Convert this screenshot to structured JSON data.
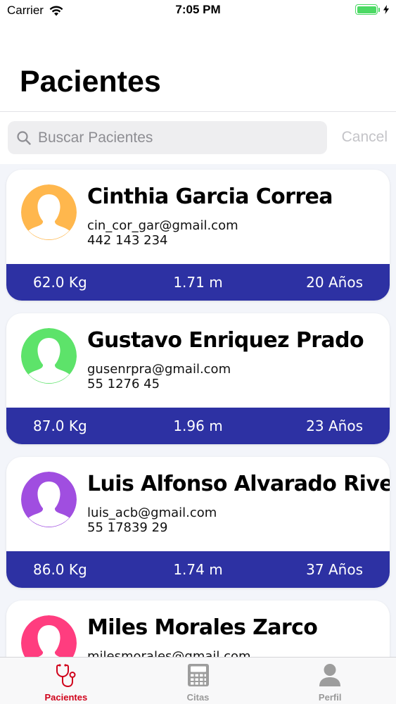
{
  "status_bar": {
    "carrier": "Carrier",
    "time": "7:05 PM"
  },
  "header": {
    "title": "Pacientes"
  },
  "search": {
    "placeholder": "Buscar Pacientes",
    "value": "",
    "cancel_label": "Cancel"
  },
  "patients": [
    {
      "name": "Cinthia Garcia Correa",
      "email": "cin_cor_gar@gmail.com",
      "phone": "442 143 234",
      "weight": "62.0 Kg",
      "height": "1.71 m",
      "age": "20 Años",
      "avatar_color": "#ffb74d"
    },
    {
      "name": "Gustavo Enriquez Prado",
      "email": "gusenrpra@gmail.com",
      "phone": "55 1276 45",
      "weight": "87.0 Kg",
      "height": "1.96 m",
      "age": "23 Años",
      "avatar_color": "#5de36a"
    },
    {
      "name": "Luis Alfonso Alvarado Rivera",
      "email": "luis_acb@gmail.com",
      "phone": "55 17839 29",
      "weight": "86.0 Kg",
      "height": "1.74 m",
      "age": "37 Años",
      "avatar_color": "#a04ee0"
    },
    {
      "name": "Miles Morales Zarco",
      "email": "milesmorales@gmail.com",
      "phone": "",
      "weight": "",
      "height": "",
      "age": "",
      "avatar_color": "#ff3d7f"
    }
  ],
  "tab_bar": {
    "tabs": [
      {
        "label": "Pacientes",
        "icon": "stethoscope-icon",
        "active": true
      },
      {
        "label": "Citas",
        "icon": "calculator-icon",
        "active": false
      },
      {
        "label": "Perfil",
        "icon": "person-icon",
        "active": false
      }
    ]
  },
  "colors": {
    "accent": "#d0021b",
    "stats_bar": "#2d31a3",
    "battery": "#4cd964",
    "inactive_tab": "#999999"
  }
}
